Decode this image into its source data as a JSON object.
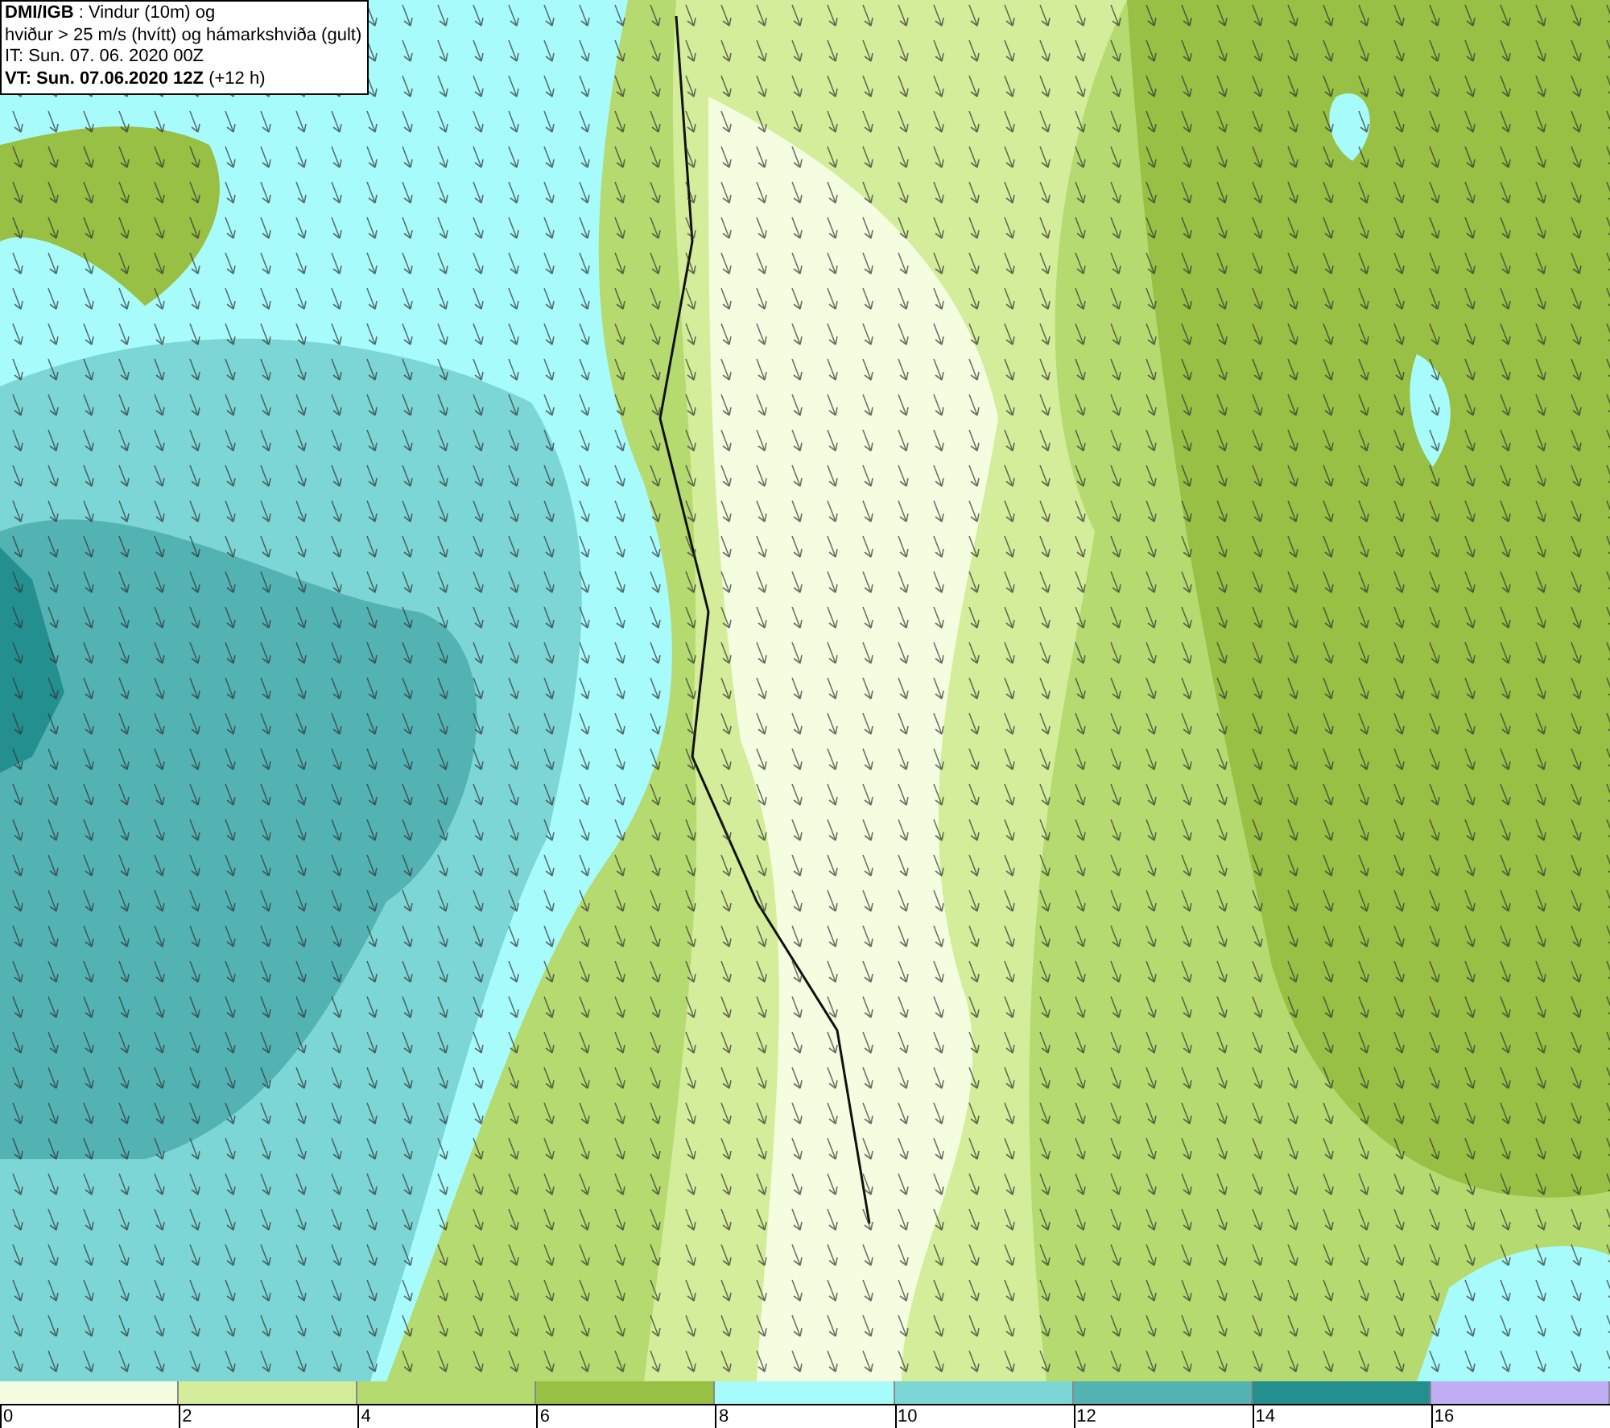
{
  "title_box": {
    "lines": [
      "**DMI/IGB** : Vindur (10m) og",
      "hviður > 25 m/s (hvítt) og hámarkshviða (gult)",
      "IT: Sun. 07. 06. 2020 00Z",
      "**VT: Sun. 07.06.2020 12Z** (+12 h)"
    ]
  },
  "legend": {
    "bins": [
      {
        "color": "#f5fde0",
        "label": "0"
      },
      {
        "color": "#d3ed9a",
        "label": "2"
      },
      {
        "color": "#b5db70",
        "label": "4"
      },
      {
        "color": "#97c045",
        "label": "6"
      },
      {
        "color": "#a8fbfb",
        "label": "8"
      },
      {
        "color": "#7dd6d6",
        "label": "10"
      },
      {
        "color": "#53b3b3",
        "label": "12"
      },
      {
        "color": "#238f8f",
        "label": "14"
      },
      {
        "color": "#c0aef5",
        "label": "16"
      }
    ]
  }
}
